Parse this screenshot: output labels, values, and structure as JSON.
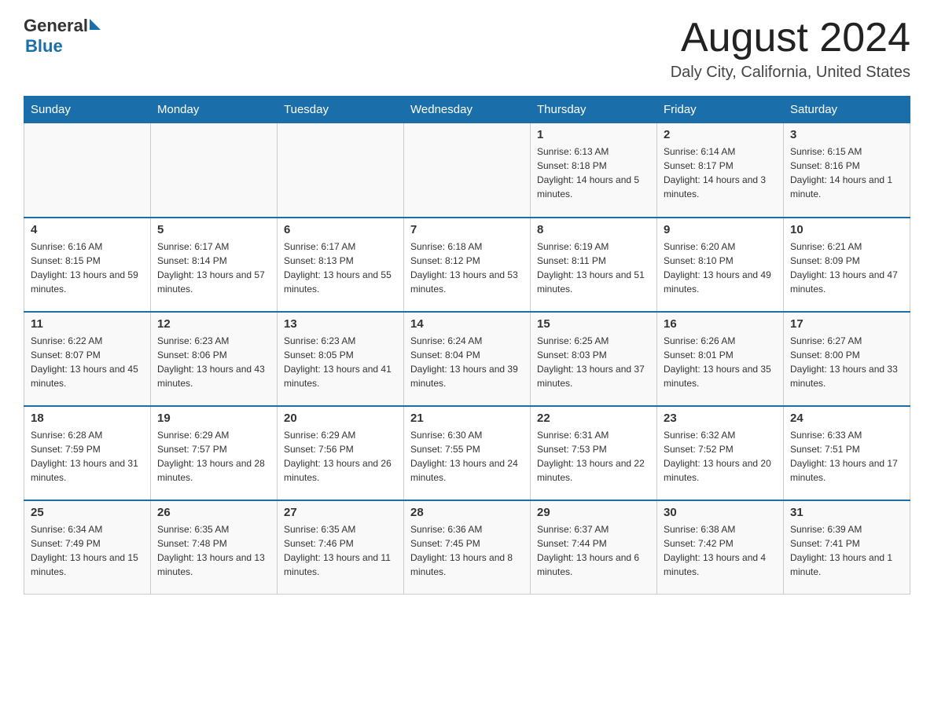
{
  "header": {
    "logo_general": "General",
    "logo_blue": "Blue",
    "month_title": "August 2024",
    "location": "Daly City, California, United States"
  },
  "days_of_week": [
    "Sunday",
    "Monday",
    "Tuesday",
    "Wednesday",
    "Thursday",
    "Friday",
    "Saturday"
  ],
  "weeks": [
    [
      {
        "day": "",
        "info": ""
      },
      {
        "day": "",
        "info": ""
      },
      {
        "day": "",
        "info": ""
      },
      {
        "day": "",
        "info": ""
      },
      {
        "day": "1",
        "info": "Sunrise: 6:13 AM\nSunset: 8:18 PM\nDaylight: 14 hours and 5 minutes."
      },
      {
        "day": "2",
        "info": "Sunrise: 6:14 AM\nSunset: 8:17 PM\nDaylight: 14 hours and 3 minutes."
      },
      {
        "day": "3",
        "info": "Sunrise: 6:15 AM\nSunset: 8:16 PM\nDaylight: 14 hours and 1 minute."
      }
    ],
    [
      {
        "day": "4",
        "info": "Sunrise: 6:16 AM\nSunset: 8:15 PM\nDaylight: 13 hours and 59 minutes."
      },
      {
        "day": "5",
        "info": "Sunrise: 6:17 AM\nSunset: 8:14 PM\nDaylight: 13 hours and 57 minutes."
      },
      {
        "day": "6",
        "info": "Sunrise: 6:17 AM\nSunset: 8:13 PM\nDaylight: 13 hours and 55 minutes."
      },
      {
        "day": "7",
        "info": "Sunrise: 6:18 AM\nSunset: 8:12 PM\nDaylight: 13 hours and 53 minutes."
      },
      {
        "day": "8",
        "info": "Sunrise: 6:19 AM\nSunset: 8:11 PM\nDaylight: 13 hours and 51 minutes."
      },
      {
        "day": "9",
        "info": "Sunrise: 6:20 AM\nSunset: 8:10 PM\nDaylight: 13 hours and 49 minutes."
      },
      {
        "day": "10",
        "info": "Sunrise: 6:21 AM\nSunset: 8:09 PM\nDaylight: 13 hours and 47 minutes."
      }
    ],
    [
      {
        "day": "11",
        "info": "Sunrise: 6:22 AM\nSunset: 8:07 PM\nDaylight: 13 hours and 45 minutes."
      },
      {
        "day": "12",
        "info": "Sunrise: 6:23 AM\nSunset: 8:06 PM\nDaylight: 13 hours and 43 minutes."
      },
      {
        "day": "13",
        "info": "Sunrise: 6:23 AM\nSunset: 8:05 PM\nDaylight: 13 hours and 41 minutes."
      },
      {
        "day": "14",
        "info": "Sunrise: 6:24 AM\nSunset: 8:04 PM\nDaylight: 13 hours and 39 minutes."
      },
      {
        "day": "15",
        "info": "Sunrise: 6:25 AM\nSunset: 8:03 PM\nDaylight: 13 hours and 37 minutes."
      },
      {
        "day": "16",
        "info": "Sunrise: 6:26 AM\nSunset: 8:01 PM\nDaylight: 13 hours and 35 minutes."
      },
      {
        "day": "17",
        "info": "Sunrise: 6:27 AM\nSunset: 8:00 PM\nDaylight: 13 hours and 33 minutes."
      }
    ],
    [
      {
        "day": "18",
        "info": "Sunrise: 6:28 AM\nSunset: 7:59 PM\nDaylight: 13 hours and 31 minutes."
      },
      {
        "day": "19",
        "info": "Sunrise: 6:29 AM\nSunset: 7:57 PM\nDaylight: 13 hours and 28 minutes."
      },
      {
        "day": "20",
        "info": "Sunrise: 6:29 AM\nSunset: 7:56 PM\nDaylight: 13 hours and 26 minutes."
      },
      {
        "day": "21",
        "info": "Sunrise: 6:30 AM\nSunset: 7:55 PM\nDaylight: 13 hours and 24 minutes."
      },
      {
        "day": "22",
        "info": "Sunrise: 6:31 AM\nSunset: 7:53 PM\nDaylight: 13 hours and 22 minutes."
      },
      {
        "day": "23",
        "info": "Sunrise: 6:32 AM\nSunset: 7:52 PM\nDaylight: 13 hours and 20 minutes."
      },
      {
        "day": "24",
        "info": "Sunrise: 6:33 AM\nSunset: 7:51 PM\nDaylight: 13 hours and 17 minutes."
      }
    ],
    [
      {
        "day": "25",
        "info": "Sunrise: 6:34 AM\nSunset: 7:49 PM\nDaylight: 13 hours and 15 minutes."
      },
      {
        "day": "26",
        "info": "Sunrise: 6:35 AM\nSunset: 7:48 PM\nDaylight: 13 hours and 13 minutes."
      },
      {
        "day": "27",
        "info": "Sunrise: 6:35 AM\nSunset: 7:46 PM\nDaylight: 13 hours and 11 minutes."
      },
      {
        "day": "28",
        "info": "Sunrise: 6:36 AM\nSunset: 7:45 PM\nDaylight: 13 hours and 8 minutes."
      },
      {
        "day": "29",
        "info": "Sunrise: 6:37 AM\nSunset: 7:44 PM\nDaylight: 13 hours and 6 minutes."
      },
      {
        "day": "30",
        "info": "Sunrise: 6:38 AM\nSunset: 7:42 PM\nDaylight: 13 hours and 4 minutes."
      },
      {
        "day": "31",
        "info": "Sunrise: 6:39 AM\nSunset: 7:41 PM\nDaylight: 13 hours and 1 minute."
      }
    ]
  ]
}
